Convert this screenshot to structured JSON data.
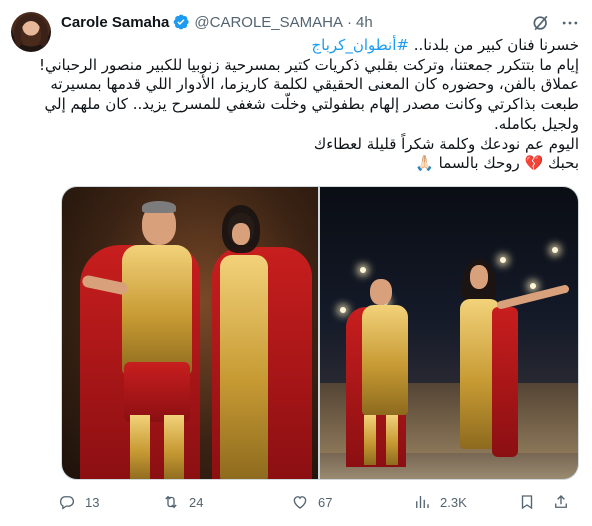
{
  "author": {
    "display_name": "Carole Samaha",
    "handle": "@CAROLE_SAMAHA",
    "separator": "·",
    "time": "4h"
  },
  "tweet": {
    "line1": "خسرنا فنان كبير من بلدنا.. ",
    "hashtag": "#أنطوان_كرباج",
    "line2": "إيام ما بتتكرر جمعتنا، وتركت بقلبي ذكريات كتير بمسرحية زنوبيا للكبير منصور الرحباني!",
    "line3": "عملاق بالفن، وحضوره كان المعنى الحقيقي لكلمة كاريزما، الأدوار اللي قدمها بمسيرته",
    "line4": "طبعت بذاكرتي وكانت مصدر إلهام بطفولتي وخلّت شغفي للمسرح يزيد.. كان ملهم إلي",
    "line5": "ولجيل بكامله.",
    "line6": "اليوم عم نودعك وكلمة شكراً قليلة لعطاءك",
    "line7": "بحبك 💔 روحك بالسما 🙏🏻"
  },
  "media": {
    "left_photo": "theatre-costume-photo-left",
    "right_photo": "theatre-costume-photo-right"
  },
  "actions": {
    "replies": "13",
    "retweets": "24",
    "likes": "67",
    "views": "2.3K"
  },
  "colors": {
    "accent": "#1d9bf0",
    "muted": "#536471",
    "text": "#0f1419",
    "border": "#cfd9de"
  },
  "icons": [
    "verified-badge-icon",
    "grok-icon",
    "more-icon",
    "reply-icon",
    "retweet-icon",
    "like-icon",
    "views-icon",
    "bookmark-icon",
    "share-icon"
  ]
}
